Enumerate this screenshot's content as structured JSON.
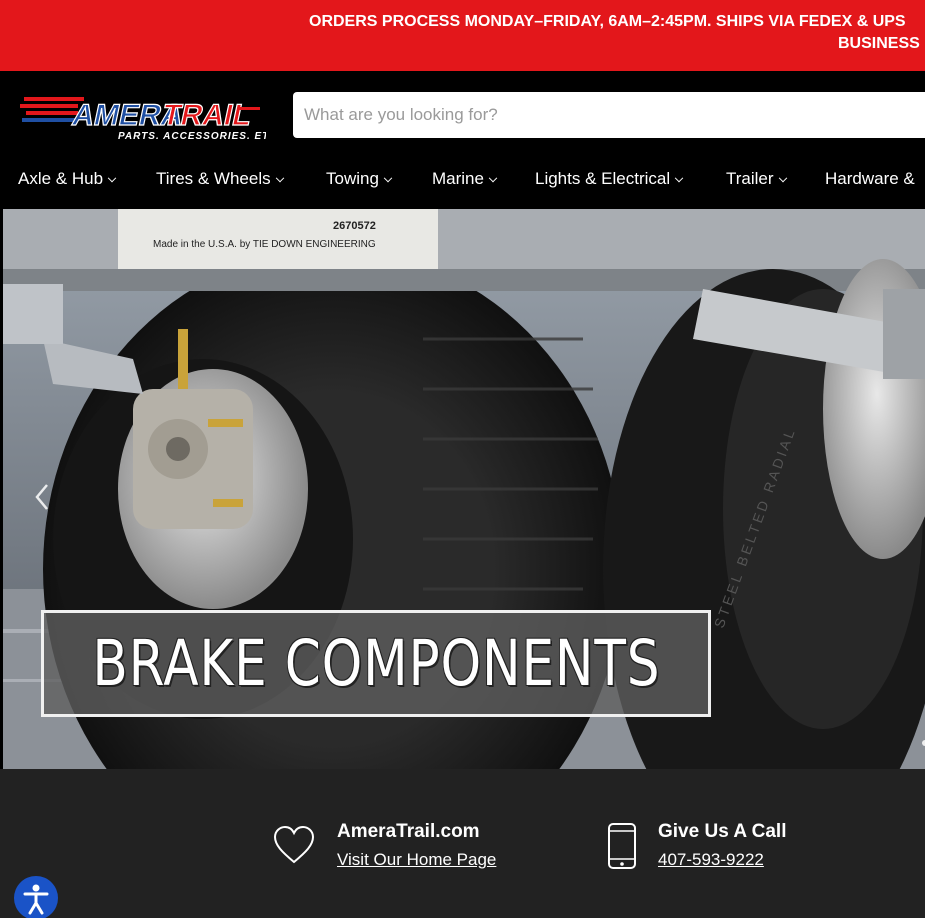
{
  "announcement": {
    "line1": "ORDERS PROCESS MONDAY–FRIDAY, 6AM–2:45PM. SHIPS VIA FEDEX & UPS",
    "line2": "BUSINESS"
  },
  "brand": {
    "name": "AMERATRAIL",
    "tagline": "PARTS. ACCESSORIES. ETC",
    "colors": {
      "red": "#e3171b",
      "blue": "#1f4fa3"
    }
  },
  "search": {
    "placeholder": "What are you looking for?",
    "value": ""
  },
  "nav": {
    "items": [
      {
        "label": "Axle & Hub"
      },
      {
        "label": "Tires & Wheels"
      },
      {
        "label": "Towing"
      },
      {
        "label": "Marine"
      },
      {
        "label": "Lights & Electrical"
      },
      {
        "label": "Trailer"
      },
      {
        "label": "Hardware &"
      }
    ]
  },
  "hero": {
    "banner_text": "BRAKE COMPONENTS",
    "prev_icon": "chevron-left-icon"
  },
  "footer": {
    "site": {
      "title": "AmeraTrail.com",
      "link": "Visit Our Home Page",
      "icon": "heart-icon"
    },
    "call": {
      "title": "Give Us A Call",
      "link": "407-593-9222",
      "icon": "phone-icon"
    }
  },
  "accessibility": {
    "icon": "accessibility-icon",
    "color": "#1a53c7"
  }
}
